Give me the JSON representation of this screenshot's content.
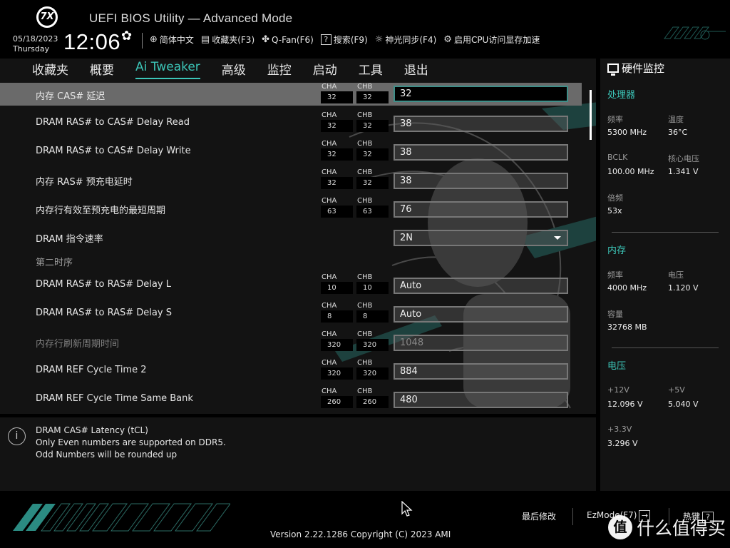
{
  "header": {
    "logo_text": "7X",
    "title": "UEFI BIOS Utility — Advanced Mode",
    "date": "05/18/2023",
    "weekday": "Thursday",
    "time": "12:06",
    "toolbar": [
      {
        "icon": "globe-icon",
        "glyph": "🌐",
        "label": "简体中文"
      },
      {
        "icon": "favorites-icon",
        "glyph": "☰",
        "label": "收藏夹(F3)"
      },
      {
        "icon": "fan-icon",
        "glyph": "✣",
        "label": "Q-Fan(F6)"
      },
      {
        "icon": "help-search-icon",
        "glyph": "?",
        "label": "搜索(F9)"
      },
      {
        "icon": "aura-sync-icon",
        "glyph": "☼",
        "label": "神光同步(F4)"
      },
      {
        "icon": "resizable-bar-icon",
        "glyph": "⚙",
        "label": "启用CPU访问显存加速"
      }
    ]
  },
  "nav": {
    "tabs": [
      {
        "label": "收藏夹",
        "active": false
      },
      {
        "label": "概要",
        "active": false
      },
      {
        "label": "Ai Tweaker",
        "active": true
      },
      {
        "label": "高级",
        "active": false
      },
      {
        "label": "监控",
        "active": false
      },
      {
        "label": "启动",
        "active": false
      },
      {
        "label": "工具",
        "active": false
      },
      {
        "label": "退出",
        "active": false
      }
    ]
  },
  "settings": {
    "channel_a_caption": "CHA",
    "channel_b_caption": "CHB",
    "section_secondary": "第二时序",
    "rows": [
      {
        "label": "内存 CAS# 延迟",
        "cha": "32",
        "chb": "32",
        "value": "32",
        "state": "selected"
      },
      {
        "label": "DRAM RAS# to CAS# Delay Read",
        "cha": "32",
        "chb": "32",
        "value": "38",
        "state": "normal"
      },
      {
        "label": "DRAM RAS# to CAS# Delay Write",
        "cha": "32",
        "chb": "32",
        "value": "38",
        "state": "normal"
      },
      {
        "label": "内存 RAS# 预充电延时",
        "cha": "32",
        "chb": "32",
        "value": "38",
        "state": "normal"
      },
      {
        "label": "内存行有效至预充电的最短周期",
        "cha": "63",
        "chb": "63",
        "value": "76",
        "state": "normal"
      },
      {
        "label": "DRAM 指令速率",
        "value": "2N",
        "state": "dropdown"
      },
      {
        "label": "DRAM RAS# to RAS# Delay L",
        "cha": "10",
        "chb": "10",
        "value": "Auto",
        "state": "normal"
      },
      {
        "label": "DRAM RAS# to RAS# Delay S",
        "cha": "8",
        "chb": "8",
        "value": "Auto",
        "state": "normal"
      },
      {
        "label": "内存行刷新周期时间",
        "cha": "320",
        "chb": "320",
        "value": "1048",
        "state": "disabled"
      },
      {
        "label": "DRAM REF Cycle Time 2",
        "cha": "320",
        "chb": "320",
        "value": "884",
        "state": "normal"
      },
      {
        "label": "DRAM REF Cycle Time Same Bank",
        "cha": "260",
        "chb": "260",
        "value": "480",
        "state": "normal"
      }
    ]
  },
  "help": {
    "lines": [
      "DRAM CAS# Latency (tCL)",
      "Only Even numbers are supported on DDR5.",
      "Odd Numbers will be rounded up"
    ]
  },
  "hw_monitor": {
    "title": "硬件监控",
    "cpu": {
      "title": "处理器",
      "freq_label": "频率",
      "freq": "5300 MHz",
      "temp_label": "温度",
      "temp": "36°C",
      "bclk_label": "BCLK",
      "bclk": "100.00 MHz",
      "vcore_label": "核心电压",
      "vcore": "1.341 V",
      "ratio_label": "倍频",
      "ratio": "53x"
    },
    "memory": {
      "title": "内存",
      "freq_label": "频率",
      "freq": "4000 MHz",
      "volt_label": "电压",
      "volt": "1.120 V",
      "cap_label": "容量",
      "cap": "32768 MB"
    },
    "voltage": {
      "title": "电压",
      "v12_label": "+12V",
      "v12": "12.096 V",
      "v5_label": "+5V",
      "v5": "5.040 V",
      "v33_label": "+3.3V",
      "v33": "3.296 V"
    }
  },
  "footer": {
    "version": "Version 2.22.1286 Copyright (C) 2023 AMI",
    "last_modified": "最后修改",
    "ezmode": "EzMode(F7)",
    "ezmode_glyph": "→",
    "hotkeys": "热键",
    "hotkeys_glyph": "?",
    "watermark_badge": "值",
    "watermark_text": "什么值得买"
  },
  "colors": {
    "accent": "#3cc6b8",
    "panel": "#131313",
    "selected_row": "#6a6a6a"
  }
}
